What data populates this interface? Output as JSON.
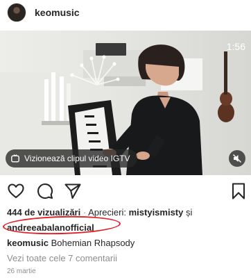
{
  "header": {
    "username": "keomusic",
    "avatar_icon": "profile-avatar"
  },
  "media": {
    "timer": "1:56",
    "igtv_label": "Vizionează clipul video IGTV",
    "tv_icon": "tv-icon",
    "mute_icon": "speaker-muted-icon"
  },
  "actions": {
    "like_icon": "heart-icon",
    "comment_icon": "comment-icon",
    "share_icon": "paper-plane-icon",
    "save_icon": "bookmark-icon"
  },
  "stats": {
    "views": "444 de vizualizări",
    "separator": " · ",
    "likes_label": "Aprecieri: ",
    "liker1": "mistyismisty",
    "conj": " și",
    "liker2": "andreeabalanofficial"
  },
  "caption": {
    "username": "keomusic",
    "text": " Bohemian Rhapsody"
  },
  "comments_link": "Vezi toate cele 7 comentarii",
  "date": "26 martie",
  "colors": {
    "highlight": "#e41e25",
    "text": "#262626",
    "muted": "#8e8e8e"
  }
}
